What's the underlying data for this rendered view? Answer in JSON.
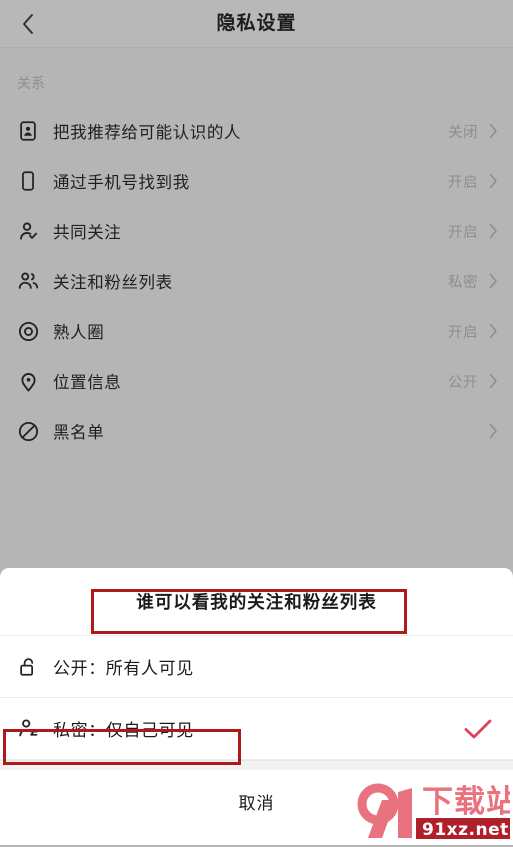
{
  "navbar": {
    "back_icon": "chevron-left-icon",
    "title": "隐私设置"
  },
  "section": {
    "label": "关系"
  },
  "rows": [
    {
      "icon": "id-card-icon",
      "label": "把我推荐给可能认识的人",
      "value": "关闭"
    },
    {
      "icon": "phone-icon",
      "label": "通过手机号找到我",
      "value": "开启"
    },
    {
      "icon": "person-check-icon",
      "label": "共同关注",
      "value": "开启"
    },
    {
      "icon": "people-group-icon",
      "label": "关注和粉丝列表",
      "value": "私密"
    },
    {
      "icon": "target-circle-icon",
      "label": "熟人圈",
      "value": "开启"
    },
    {
      "icon": "location-pin-icon",
      "label": "位置信息",
      "value": "公开"
    },
    {
      "icon": "ban-icon",
      "label": "黑名单",
      "value": ""
    }
  ],
  "sheet": {
    "title": "谁可以看我的关注和粉丝列表",
    "options": [
      {
        "icon": "unlock-icon",
        "label": "公开：所有人可见",
        "selected": false
      },
      {
        "icon": "person-private-icon",
        "label": "私密：仅自己可见",
        "selected": true
      }
    ],
    "cancel_label": "取消",
    "check_icon": "check-icon"
  },
  "annotations": {
    "box_color": "#ad1a1a",
    "check_color": "#e0415c"
  },
  "watermark": {
    "logo_text": "91",
    "brand_text": "下载站",
    "url_text": "91xz.net",
    "color": "#e8737f",
    "banner_color": "#b0202a"
  }
}
